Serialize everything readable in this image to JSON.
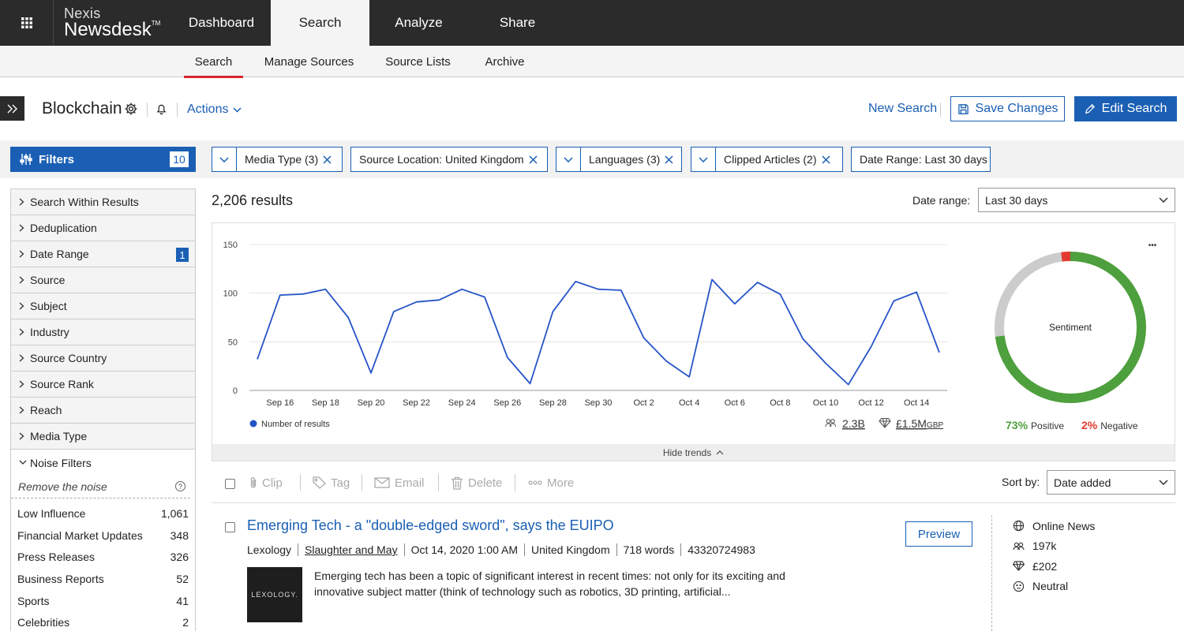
{
  "brand": {
    "line1": "Nexis",
    "line2": "Newsdesk",
    "tm": "TM"
  },
  "top_nav": [
    {
      "label": "Dashboard",
      "active": false
    },
    {
      "label": "Search",
      "active": true
    },
    {
      "label": "Analyze",
      "active": false
    },
    {
      "label": "Share",
      "active": false
    }
  ],
  "sub_nav": [
    {
      "label": "Search",
      "active": true
    },
    {
      "label": "Manage Sources",
      "active": false
    },
    {
      "label": "Source Lists",
      "active": false
    },
    {
      "label": "Archive",
      "active": false
    }
  ],
  "header": {
    "search_name": "Blockchain",
    "actions_label": "Actions",
    "new_search_label": "New Search",
    "save_label": "Save Changes",
    "edit_label": "Edit Search"
  },
  "filters_button": {
    "label": "Filters",
    "count": "10"
  },
  "chips": [
    {
      "label": "Media Type (3)",
      "dropdown": true,
      "removable": true
    },
    {
      "label": "Source Location: United Kingdom",
      "dropdown": false,
      "removable": true
    },
    {
      "label": "Languages (3)",
      "dropdown": true,
      "removable": true
    },
    {
      "label": "Clipped Articles (2)",
      "dropdown": true,
      "removable": true
    },
    {
      "label": "Date Range: Last 30 days",
      "dropdown": false,
      "removable": false
    }
  ],
  "facets": [
    {
      "label": "Search Within Results",
      "badge": ""
    },
    {
      "label": "Deduplication",
      "badge": ""
    },
    {
      "label": "Date Range",
      "badge": "1"
    },
    {
      "label": "Source",
      "badge": ""
    },
    {
      "label": "Subject",
      "badge": ""
    },
    {
      "label": "Industry",
      "badge": ""
    },
    {
      "label": "Source Country",
      "badge": ""
    },
    {
      "label": "Source Rank",
      "badge": ""
    },
    {
      "label": "Reach",
      "badge": ""
    },
    {
      "label": "Media Type",
      "badge": ""
    }
  ],
  "noise_filters": {
    "label": "Noise Filters",
    "subtitle": "Remove the noise",
    "help": "?",
    "items": [
      {
        "label": "Low Influence",
        "count": "1,061"
      },
      {
        "label": "Financial Market Updates",
        "count": "348"
      },
      {
        "label": "Press Releases",
        "count": "326"
      },
      {
        "label": "Business Reports",
        "count": "52"
      },
      {
        "label": "Sports",
        "count": "41"
      },
      {
        "label": "Celebrities",
        "count": "2"
      }
    ]
  },
  "results": {
    "count_label": "2,206 results",
    "date_range_label": "Date range:",
    "date_range_value": "Last 30 days",
    "sort_label": "Sort by:",
    "sort_value": "Date added"
  },
  "chart_data": {
    "type": "line",
    "ylim": [
      0,
      150
    ],
    "yticks": [
      0,
      50,
      100,
      150
    ],
    "tick_labels": [
      "Sep 16",
      "Sep 18",
      "Sep 20",
      "Sep 22",
      "Sep 24",
      "Sep 26",
      "Sep 28",
      "Sep 30",
      "Oct 2",
      "Oct 4",
      "Oct 6",
      "Oct 8",
      "Oct 10",
      "Oct 12",
      "Oct 14"
    ],
    "series": [
      {
        "name": "Number of results",
        "color": "#2554c7",
        "values": [
          32,
          98,
          99,
          104,
          75,
          18,
          81,
          91,
          93,
          104,
          96,
          34,
          7,
          81,
          112,
          104,
          103,
          54,
          30,
          14,
          114,
          89,
          111,
          99,
          53,
          28,
          6,
          45,
          92,
          101,
          39
        ]
      }
    ],
    "legend": "bottom-left",
    "reach": "2.3B",
    "value": "£1.5M",
    "currency": "GBP",
    "sentiment": {
      "label": "Sentiment",
      "positive_pct": 73,
      "negative_pct": 2,
      "neutral_pct": 25,
      "positive_label": "73%",
      "positive_word": "Positive",
      "negative_label": "2%",
      "negative_word": "Negative",
      "colors": {
        "positive": "#4e9f3d",
        "negative": "#e23a2e",
        "neutral": "#cccccc"
      }
    },
    "more_label": "•••",
    "hide_trends": "Hide trends"
  },
  "toolbar": [
    {
      "label": "Clip",
      "icon": "paperclip-icon"
    },
    {
      "label": "Tag",
      "icon": "tag-icon"
    },
    {
      "label": "Email",
      "icon": "email-icon"
    },
    {
      "label": "Delete",
      "icon": "trash-icon"
    },
    {
      "label": "More",
      "icon": "more-icon"
    }
  ],
  "article": {
    "title": "Emerging Tech - a \"double-edged sword\", says the EUIPO",
    "meta": [
      "Lexology",
      "Slaughter and May",
      "Oct 14, 2020 1:00 AM",
      "United Kingdom",
      "718 words",
      "43320724983"
    ],
    "thumb_text": "LEXOLOGY.",
    "snippet": "Emerging tech has been a topic of significant interest in recent times: not only for its exciting and innovative subject matter (think of technology such as robotics, 3D printing, artificial...",
    "preview_label": "Preview",
    "media_type": "Online News",
    "reach": "197k",
    "value": "£202",
    "sentiment": "Neutral"
  }
}
